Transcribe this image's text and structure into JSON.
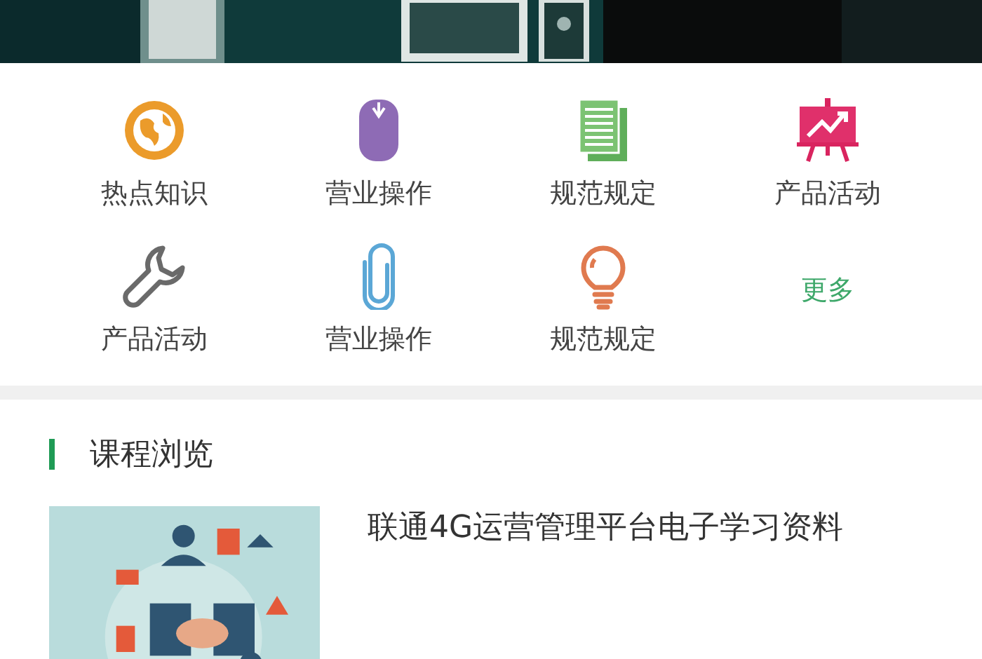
{
  "categories": [
    {
      "kind": "globe",
      "label": "热点知识"
    },
    {
      "kind": "mouse",
      "label": "营业操作"
    },
    {
      "kind": "document",
      "label": "规范规定"
    },
    {
      "kind": "chart",
      "label": "产品活动"
    },
    {
      "kind": "wrench",
      "label": "产品活动"
    },
    {
      "kind": "paperclip",
      "label": "营业操作"
    },
    {
      "kind": "bulb",
      "label": "规范规定"
    },
    {
      "kind": "more",
      "label": "更多"
    }
  ],
  "section": {
    "title": "课程浏览"
  },
  "courses": [
    {
      "title": "联通4G运营管理平台电子学习资料"
    }
  ]
}
